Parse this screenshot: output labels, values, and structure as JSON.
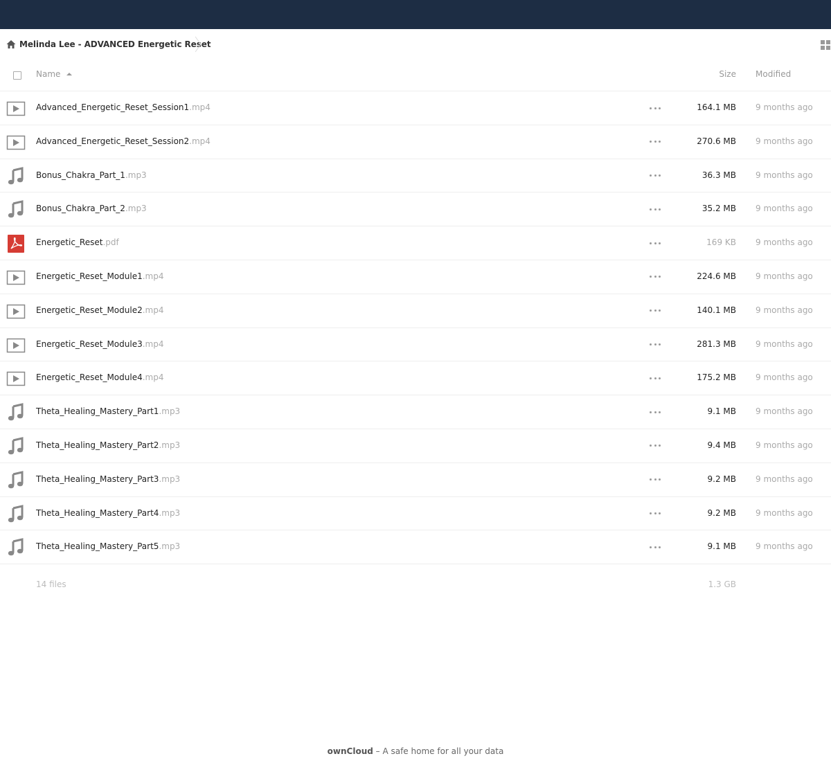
{
  "breadcrumb": {
    "home_icon": "home-icon",
    "label": "Melinda Lee - ADVANCED Energetic Reset"
  },
  "header": {
    "name_label": "Name",
    "size_label": "Size",
    "modified_label": "Modified"
  },
  "files": [
    {
      "base": "Advanced_Energetic_Reset_Session1",
      "ext": ".mp4",
      "icon": "video-file-icon",
      "size": "164.1 MB",
      "modified": "9 months ago"
    },
    {
      "base": "Advanced_Energetic_Reset_Session2",
      "ext": ".mp4",
      "icon": "video-file-icon",
      "size": "270.6 MB",
      "modified": "9 months ago"
    },
    {
      "base": "Bonus_Chakra_Part_1",
      "ext": ".mp3",
      "icon": "audio-file-icon",
      "size": "36.3 MB",
      "modified": "9 months ago"
    },
    {
      "base": "Bonus_Chakra_Part_2",
      "ext": ".mp3",
      "icon": "audio-file-icon",
      "size": "35.2 MB",
      "modified": "9 months ago"
    },
    {
      "base": "Energetic_Reset",
      "ext": ".pdf",
      "icon": "pdf-file-icon",
      "size": "169 KB",
      "modified": "9 months ago"
    },
    {
      "base": "Energetic_Reset_Module1",
      "ext": ".mp4",
      "icon": "video-file-icon",
      "size": "224.6 MB",
      "modified": "9 months ago"
    },
    {
      "base": "Energetic_Reset_Module2",
      "ext": ".mp4",
      "icon": "video-file-icon",
      "size": "140.1 MB",
      "modified": "9 months ago"
    },
    {
      "base": "Energetic_Reset_Module3",
      "ext": ".mp4",
      "icon": "video-file-icon",
      "size": "281.3 MB",
      "modified": "9 months ago"
    },
    {
      "base": "Energetic_Reset_Module4",
      "ext": ".mp4",
      "icon": "video-file-icon",
      "size": "175.2 MB",
      "modified": "9 months ago"
    },
    {
      "base": "Theta_Healing_Mastery_Part1",
      "ext": ".mp3",
      "icon": "audio-file-icon",
      "size": "9.1 MB",
      "modified": "9 months ago"
    },
    {
      "base": "Theta_Healing_Mastery_Part2",
      "ext": ".mp3",
      "icon": "audio-file-icon",
      "size": "9.4 MB",
      "modified": "9 months ago"
    },
    {
      "base": "Theta_Healing_Mastery_Part3",
      "ext": ".mp3",
      "icon": "audio-file-icon",
      "size": "9.2 MB",
      "modified": "9 months ago"
    },
    {
      "base": "Theta_Healing_Mastery_Part4",
      "ext": ".mp3",
      "icon": "audio-file-icon",
      "size": "9.2 MB",
      "modified": "9 months ago"
    },
    {
      "base": "Theta_Healing_Mastery_Part5",
      "ext": ".mp3",
      "icon": "audio-file-icon",
      "size": "9.1 MB",
      "modified": "9 months ago"
    }
  ],
  "summary": {
    "count": "14 files",
    "total_size": "1.3 GB"
  },
  "footer": {
    "brand": "ownCloud",
    "tagline": " – A safe home for all your data"
  },
  "colors": {
    "topbar": "#1d2d44",
    "pdf_red": "#d63c34",
    "icon_gray": "#888888"
  }
}
